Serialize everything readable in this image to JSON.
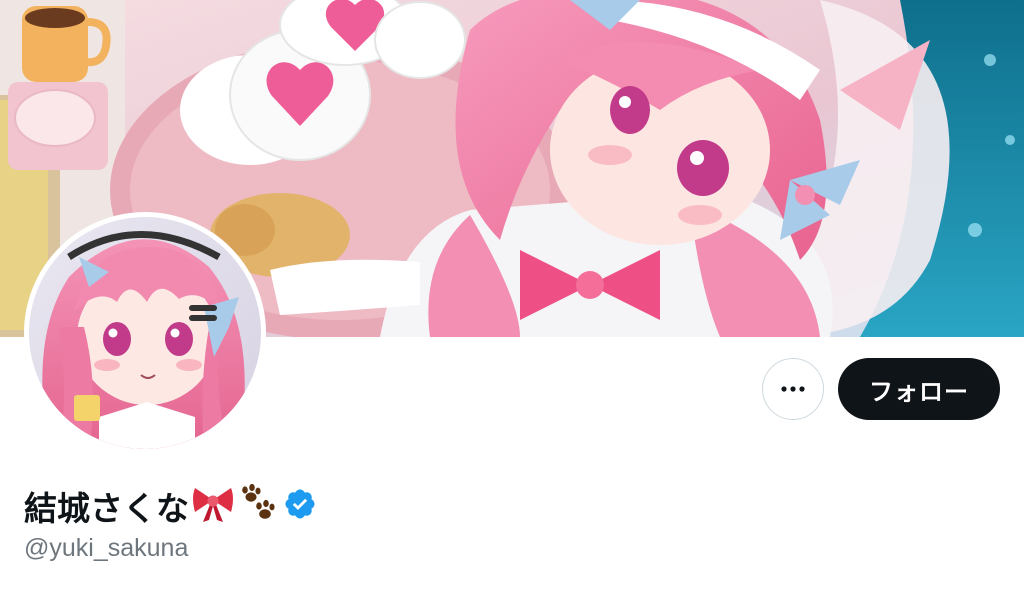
{
  "profile": {
    "display_name": "結城さくな",
    "name_emojis": [
      "ribbon-icon",
      "paw-prints-icon"
    ],
    "verified": true,
    "handle": "@yuki_sakuna"
  },
  "actions": {
    "more_label": "⋯",
    "follow_label": "フォロー"
  },
  "colors": {
    "follow_bg": "#0f1419",
    "follow_text": "#ffffff",
    "verified_badge": "#1d9bf0",
    "handle_text": "#6e767d",
    "banner_accent_pink": "#f08bb4"
  }
}
